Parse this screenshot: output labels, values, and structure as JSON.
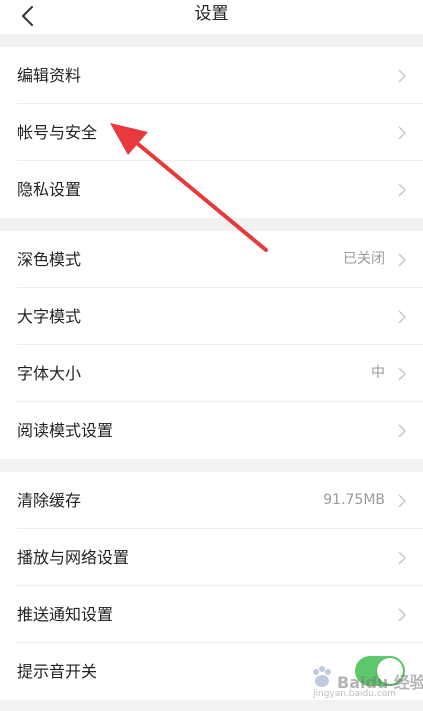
{
  "header": {
    "title": "设置",
    "back_icon": "chevron-left-icon"
  },
  "groups": [
    {
      "items": [
        {
          "label": "编辑资料"
        },
        {
          "label": "帐号与安全"
        },
        {
          "label": "隐私设置"
        }
      ]
    },
    {
      "items": [
        {
          "label": "深色模式",
          "value": "已关闭"
        },
        {
          "label": "大字模式"
        },
        {
          "label": "字体大小",
          "value": "中"
        },
        {
          "label": "阅读模式设置"
        }
      ]
    },
    {
      "items": [
        {
          "label": "清除缓存",
          "value": "91.75MB"
        },
        {
          "label": "播放与网络设置"
        },
        {
          "label": "推送通知设置"
        },
        {
          "label": "提示音开关",
          "toggle": true
        }
      ]
    }
  ],
  "watermark": {
    "brand": "Baidu 经验",
    "url": "jingyan.baidu.com"
  },
  "colors": {
    "toggle_on": "#5cc86b",
    "arrow": "#e8393c",
    "background": "#f2f2f2"
  }
}
